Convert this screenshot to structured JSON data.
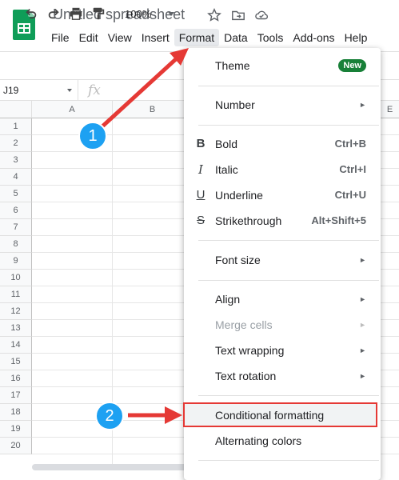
{
  "header": {
    "title": "Untitled spreadsheet",
    "menu": [
      "File",
      "Edit",
      "View",
      "Insert",
      "Format",
      "Data",
      "Tools",
      "Add-ons",
      "Help"
    ]
  },
  "toolbar": {
    "zoom": "100%"
  },
  "formula_bar": {
    "name_box": "J19",
    "fx_label": "fx"
  },
  "grid": {
    "columns": [
      "A",
      "B",
      "E"
    ],
    "rows": [
      "1",
      "2",
      "3",
      "4",
      "5",
      "6",
      "7",
      "8",
      "9",
      "10",
      "11",
      "12",
      "13",
      "14",
      "15",
      "16",
      "17",
      "18",
      "19",
      "20"
    ]
  },
  "format_menu": {
    "theme": {
      "label": "Theme",
      "badge": "New"
    },
    "number": "Number",
    "bold": {
      "label": "Bold",
      "shortcut": "Ctrl+B",
      "icon_text": "B"
    },
    "italic": {
      "label": "Italic",
      "shortcut": "Ctrl+I",
      "icon_text": "I"
    },
    "underline": {
      "label": "Underline",
      "shortcut": "Ctrl+U",
      "icon_text": "U"
    },
    "strikethrough": {
      "label": "Strikethrough",
      "shortcut": "Alt+Shift+5",
      "icon_text": "S"
    },
    "font_size": "Font size",
    "align": "Align",
    "merge_cells": "Merge cells",
    "text_wrapping": "Text wrapping",
    "text_rotation": "Text rotation",
    "conditional_formatting": "Conditional formatting",
    "alternating_colors": "Alternating colors",
    "submenu_arrow": "►"
  },
  "callouts": {
    "first": "1",
    "second": "2"
  },
  "colors": {
    "callout": "#1da1f2",
    "arrow": "#e53935",
    "sheets_green": "#0f9d58"
  },
  "icons": [
    "sheets-logo",
    "star-icon",
    "move-to-folder-icon",
    "cloud-saved-icon",
    "undo-icon",
    "redo-icon",
    "print-icon",
    "paint-format-icon"
  ]
}
